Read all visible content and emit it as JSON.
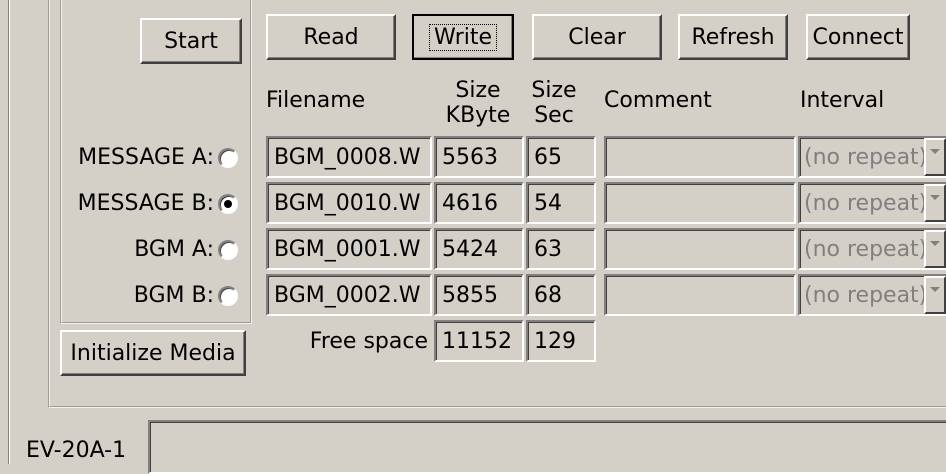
{
  "buttons": {
    "start": "Start",
    "read": "Read",
    "write": "Write",
    "clear": "Clear",
    "refresh": "Refresh",
    "connect": "Connect",
    "initialize_media": "Initialize Media"
  },
  "headers": {
    "filename": "Filename",
    "size_kbyte_line1": "Size",
    "size_kbyte_line2": "KByte",
    "size_sec_line1": "Size",
    "size_sec_line2": "Sec",
    "comment": "Comment",
    "interval": "Interval"
  },
  "rows": [
    {
      "label": "MESSAGE A:",
      "selected": false,
      "filename": "BGM_0008.W",
      "kbyte": "5563",
      "sec": "65",
      "comment": "",
      "interval": "(no repeat)"
    },
    {
      "label": "MESSAGE B:",
      "selected": true,
      "filename": "BGM_0010.W",
      "kbyte": "4616",
      "sec": "54",
      "comment": "",
      "interval": "(no repeat)"
    },
    {
      "label": "BGM A:",
      "selected": false,
      "filename": "BGM_0001.W",
      "kbyte": "5424",
      "sec": "63",
      "comment": "",
      "interval": "(no repeat)"
    },
    {
      "label": "BGM B:",
      "selected": false,
      "filename": "BGM_0002.W",
      "kbyte": "5855",
      "sec": "68",
      "comment": "",
      "interval": "(no repeat)"
    }
  ],
  "free_space": {
    "label": "Free space",
    "kbyte": "11152",
    "sec": "129"
  },
  "status": {
    "device": "EV-20A-1",
    "value": ""
  }
}
